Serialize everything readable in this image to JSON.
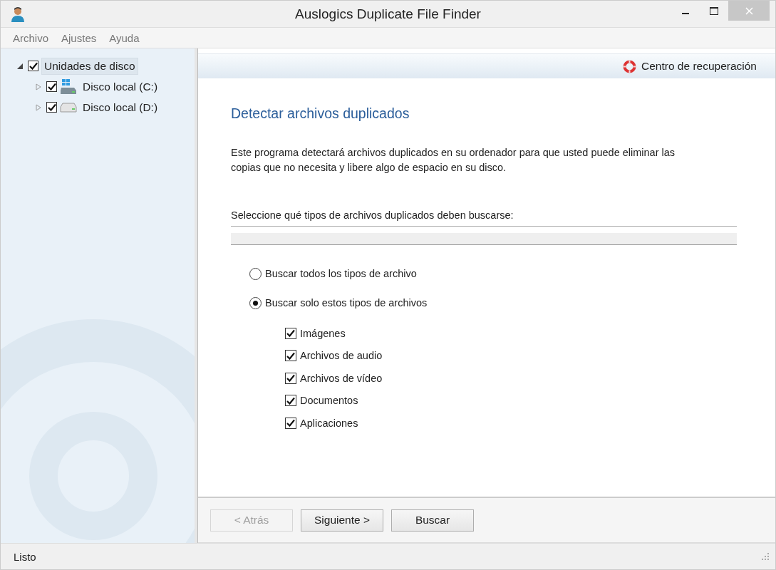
{
  "window": {
    "title": "Auslogics Duplicate File Finder"
  },
  "menu": [
    "Archivo",
    "Ajustes",
    "Ayuda"
  ],
  "tree": [
    {
      "label": "Unidades de disco",
      "checked": true,
      "expanded": true,
      "selected": true,
      "children": [
        {
          "label": "Disco local (C:)",
          "checked": true,
          "expanded": false,
          "selected": false,
          "kind": "system-drive"
        },
        {
          "label": "Disco local (D:)",
          "checked": true,
          "expanded": false,
          "selected": false,
          "kind": "drive"
        }
      ]
    }
  ],
  "header_link": "Centro de recuperación",
  "page": {
    "title": "Detectar archivos duplicados",
    "description": "Este programa detectará archivos duplicados en su ordenador para que usted puede eliminar las copias que no necesita y libere algo de espacio en su disco.",
    "prompt": "Seleccione qué tipos de archivos duplicados deben buscarse:",
    "options": [
      {
        "label": "Buscar todos los tipos de archivo",
        "selected": false
      },
      {
        "label": "Buscar solo estos tipos de archivos",
        "selected": true
      }
    ],
    "file_types": [
      {
        "label": "Imágenes",
        "checked": true
      },
      {
        "label": "Archivos de audio",
        "checked": true
      },
      {
        "label": "Archivos de vídeo",
        "checked": true
      },
      {
        "label": "Documentos",
        "checked": true
      },
      {
        "label": "Aplicaciones",
        "checked": true
      }
    ]
  },
  "buttons": [
    {
      "label": "< Atrás",
      "disabled": true
    },
    {
      "label": "Siguiente >",
      "disabled": false
    },
    {
      "label": "Buscar",
      "disabled": false
    }
  ],
  "status_bar": "Listo"
}
